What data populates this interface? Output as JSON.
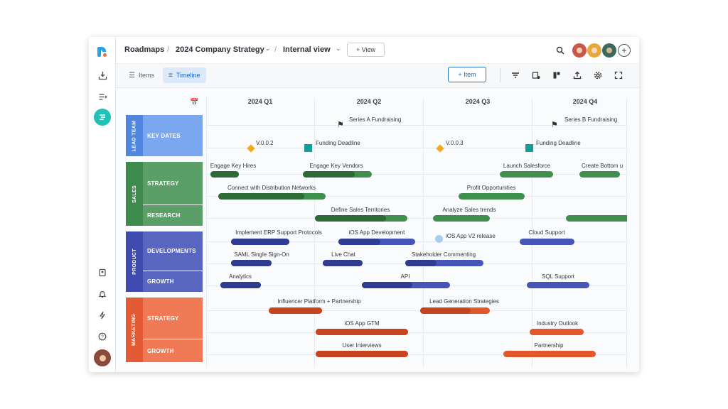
{
  "breadcrumb": {
    "root": "Roadmaps",
    "roadmap": "2024 Company Strategy",
    "view": "Internal view"
  },
  "header": {
    "add_view_label": "+ View"
  },
  "tabs": [
    {
      "label": "Items"
    },
    {
      "label": "Timeline"
    }
  ],
  "toolbar": {
    "add_item_label": "+ Item"
  },
  "quarters": [
    "2024 Q1",
    "2024 Q2",
    "2024 Q3",
    "2024 Q4"
  ],
  "lanes": {
    "lead_team": {
      "team": "LEAD TEAM",
      "rows": [
        "KEY DATES"
      ]
    },
    "sales": {
      "team": "SALES",
      "rows": [
        "STRATEGY",
        "RESEARCH"
      ]
    },
    "product": {
      "team": "PRODUCT",
      "rows": [
        "DEVELOPMENTS",
        "GROWTH"
      ]
    },
    "marketing": {
      "team": "MARKETING",
      "rows": [
        "STRATEGY",
        "GROWTH"
      ]
    }
  },
  "milestones": {
    "series_a": "Series A Fundraising",
    "series_b": "Series B Fundraising",
    "v002": "V.0.0.2",
    "funding1": "Funding Deadline",
    "v003": "V.0.0.3",
    "funding2": "Funding Deadline",
    "ios_v2": "iOS App V2 release"
  },
  "items": {
    "engage_hires": "Engage Key Hires",
    "engage_vendors": "Engage Key Vendors",
    "launch_salesforce": "Launch Salesforce",
    "create_bottom": "Create Bottom u",
    "connect_dist": "Connect with Distribution Networks",
    "profit_opps": "Profit Opportunities",
    "define_territories": "Define Sales Territories",
    "analyze_trends": "Analyze Sales trends",
    "erp": "Implement ERP Support Protocols",
    "ios_dev": "iOS App Development",
    "cloud_support": "Cloud Support",
    "saml": "SAML Single Sign-On",
    "live_chat": "Live Chat",
    "stakeholder": "Stakeholder Commenting",
    "analytics": "Analytics",
    "api": "API",
    "sql": "SQL Support",
    "influencer": "Influencer Platform + Partnership",
    "lead_gen": "Lead Generation Strategies",
    "ios_gtm": "iOS App GTM",
    "industry_outlook": "Industry Outlook",
    "user_interviews": "User Interviews",
    "partnership": "Partnership"
  },
  "colors": {
    "lead_team": "#7aa7ef",
    "lead_team_dark": "#4f86e0",
    "sales": "#5c9e68",
    "sales_dark": "#3e8a4d",
    "sales_bar": "#3f8f4f",
    "sales_prog": "#2c6b38",
    "product": "#5966bf",
    "product_dark": "#3f4ab0",
    "product_bar": "#4656b8",
    "product_prog": "#2f3c8f",
    "marketing": "#f07a55",
    "marketing_dark": "#e25b35",
    "marketing_bar": "#e2572b",
    "marketing_prog": "#c84420"
  }
}
